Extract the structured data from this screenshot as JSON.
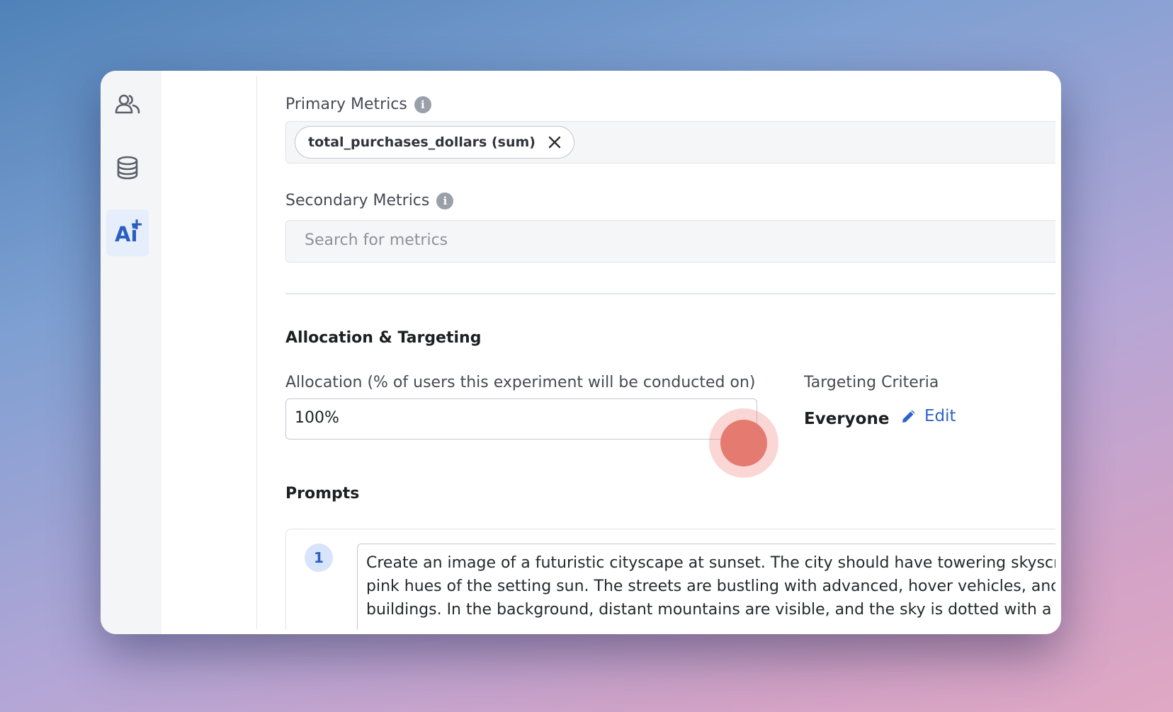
{
  "sidebar": {
    "items": [
      {
        "icon": "users-icon",
        "active": false
      },
      {
        "icon": "database-icon",
        "active": false
      },
      {
        "icon": "ai-sparkle-icon",
        "label": "Ai",
        "active": true
      }
    ]
  },
  "primary_metrics": {
    "label": "Primary Metrics",
    "selected": [
      {
        "label": "total_purchases_dollars (sum)"
      }
    ]
  },
  "secondary_metrics": {
    "label": "Secondary Metrics",
    "placeholder": "Search for metrics"
  },
  "allocation_targeting": {
    "title": "Allocation & Targeting",
    "allocation_label": "Allocation (% of users this experiment will be conducted on)",
    "allocation_value": "100%",
    "targeting_label": "Targeting Criteria",
    "targeting_value": "Everyone",
    "edit_label": "Edit"
  },
  "prompts": {
    "title": "Prompts",
    "items": [
      {
        "number": "1",
        "lines": [
          "Create an image of a futuristic cityscape at sunset. The city should have towering skyscr",
          "pink hues of the setting sun. The streets are bustling with advanced, hover vehicles, and",
          "buildings. In the background, distant mountains are visible, and the sky is dotted with a fe"
        ]
      }
    ]
  },
  "colors": {
    "accent": "#2f63c8",
    "click_indicator": "#e57a70"
  }
}
